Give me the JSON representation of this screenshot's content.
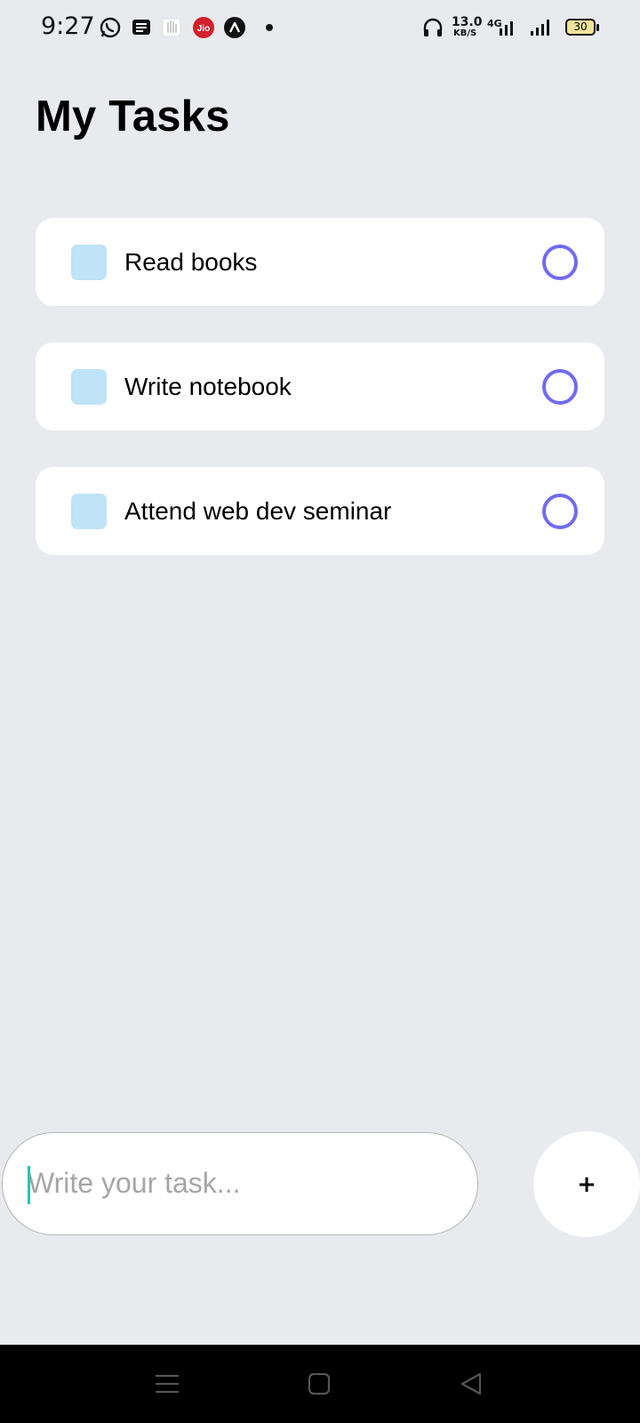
{
  "status_bar": {
    "time": "9:27",
    "network_speed_value": "13.0",
    "network_speed_unit": "KB/S",
    "network_type": "4G",
    "battery_level": "30",
    "left_icons": [
      "whatsapp-icon",
      "message-icon",
      "hand-icon",
      "jio-icon",
      "app-a-icon",
      "dot-indicator"
    ],
    "right_icons": [
      "headphones-icon",
      "signal-4g-icon",
      "signal-icon",
      "battery-icon"
    ]
  },
  "header": {
    "title": "My Tasks"
  },
  "tasks": [
    {
      "label": "Read books"
    },
    {
      "label": "Write notebook"
    },
    {
      "label": "Attend web dev seminar"
    }
  ],
  "composer": {
    "input_value": "",
    "input_placeholder": "Write your task...",
    "add_label": "+"
  },
  "nav_bar": {
    "buttons": [
      "menu-icon",
      "home-icon",
      "back-icon"
    ]
  },
  "colors": {
    "background": "#e8eaed",
    "card": "#ffffff",
    "task_square": "#bfe3f7",
    "task_circle": "#716bf0",
    "caret": "#1ec8b4",
    "nav_bar": "#000000"
  }
}
